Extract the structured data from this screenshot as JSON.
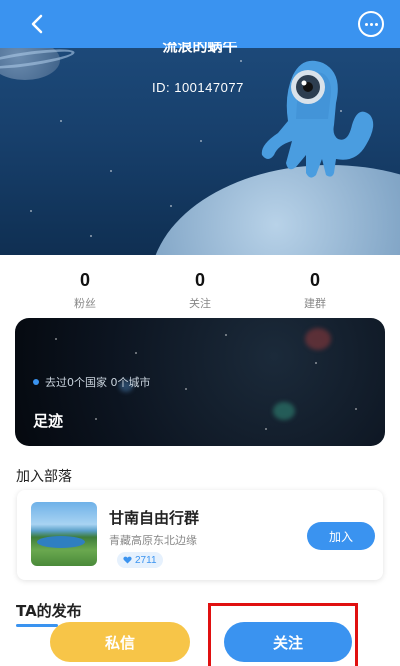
{
  "header": {
    "nickname": "流浪的蜗牛",
    "id_text": "ID: 100147077"
  },
  "stats": [
    {
      "value": "0",
      "label": "粉丝"
    },
    {
      "value": "0",
      "label": "关注"
    },
    {
      "value": "0",
      "label": "建群"
    }
  ],
  "footprint": {
    "summary": "去过0个国家  0个城市",
    "title": "足迹"
  },
  "tribe_section": {
    "title": "加入部落",
    "tribe": {
      "name": "甘南自由行群",
      "description": "青藏高原东北边缘",
      "member_count": "2711",
      "join_label": "加入"
    }
  },
  "posts_section": {
    "title": "TA的发布"
  },
  "actions": {
    "message_label": "私信",
    "follow_label": "关注"
  },
  "colors": {
    "primary": "#3a93f0",
    "message_button": "#f7c548",
    "highlight": "#e01010"
  }
}
